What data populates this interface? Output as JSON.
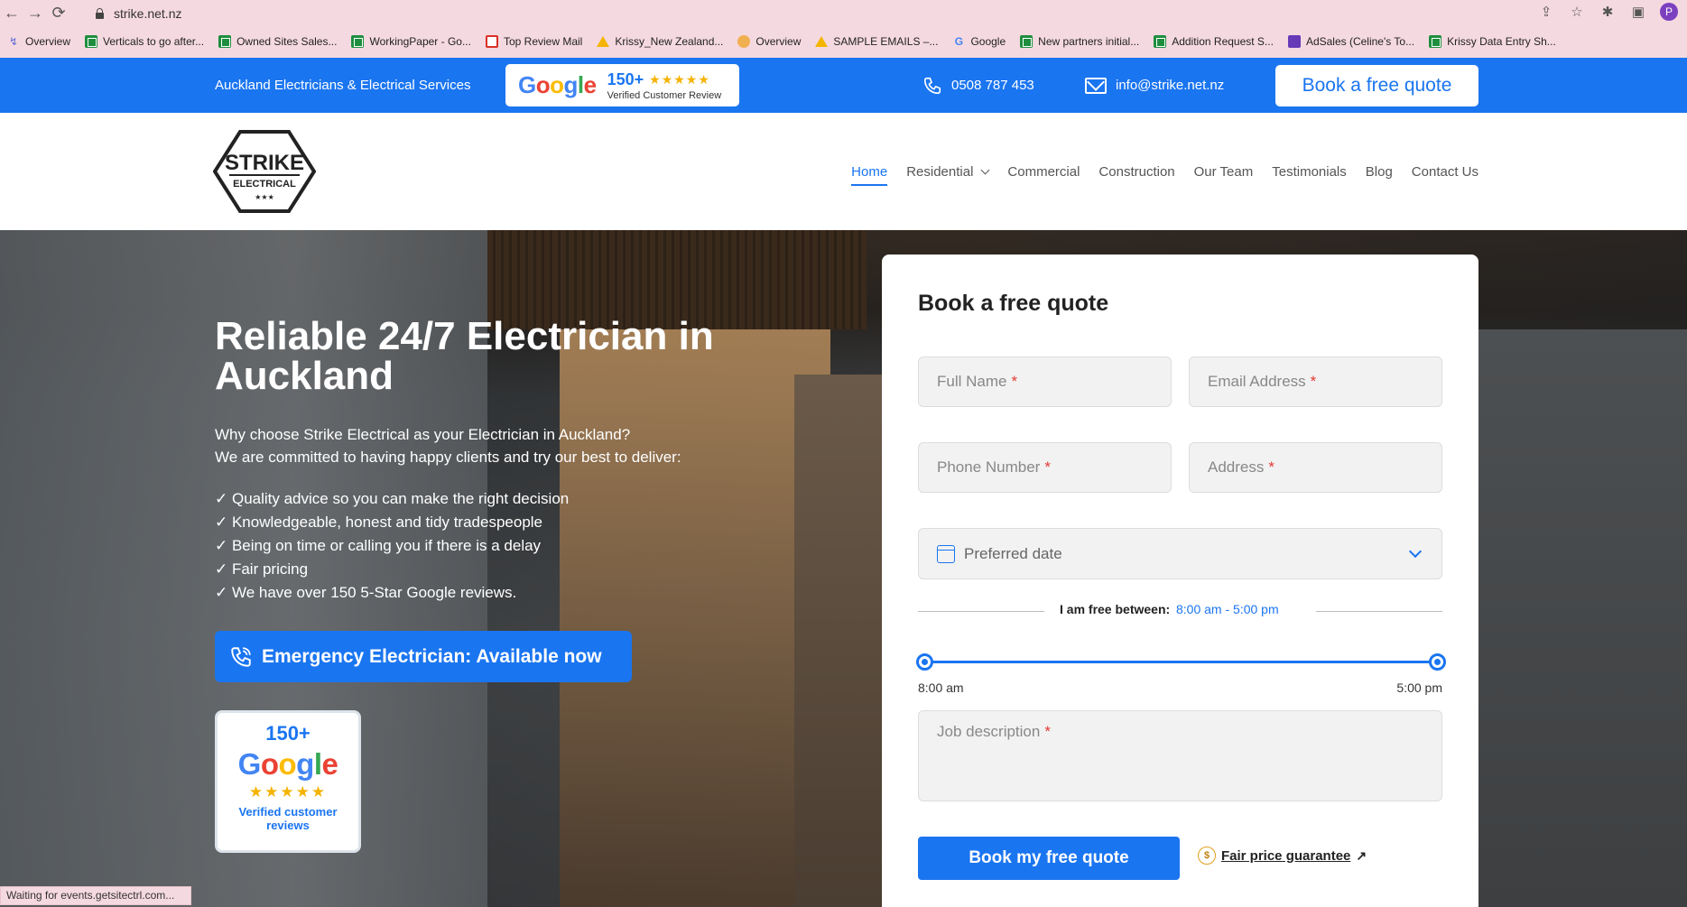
{
  "browser": {
    "url": "strike.net.nz",
    "profile_initial": "P",
    "bookmarks": [
      {
        "label": "Overview",
        "icon": "overview-icon"
      },
      {
        "label": "Verticals to go after...",
        "icon": "sheets-icon"
      },
      {
        "label": "Owned Sites Sales...",
        "icon": "sheets-icon"
      },
      {
        "label": "WorkingPaper - Go...",
        "icon": "sheets-icon"
      },
      {
        "label": "Top Review Mail",
        "icon": "gmail-icon"
      },
      {
        "label": "Krissy_New Zealand...",
        "icon": "drive-icon"
      },
      {
        "label": "Overview",
        "icon": "compass-icon"
      },
      {
        "label": "SAMPLE EMAILS –...",
        "icon": "drive-icon"
      },
      {
        "label": "Google",
        "icon": "google-icon"
      },
      {
        "label": "New partners initial...",
        "icon": "sheets-icon"
      },
      {
        "label": "Addition Request S...",
        "icon": "sheets-icon"
      },
      {
        "label": "AdSales (Celine's To...",
        "icon": "forms-icon"
      },
      {
        "label": "Krissy Data Entry Sh...",
        "icon": "sheets-icon"
      }
    ],
    "status_text": "Waiting for events.getsitectrl.com..."
  },
  "topbar": {
    "tagline": "Auckland Electricians & Electrical Services",
    "google_word": [
      "G",
      "o",
      "o",
      "g",
      "l",
      "e"
    ],
    "review_count": "150+",
    "stars": "★★★★★",
    "review_sub": "Verified Customer Review",
    "phone": "0508 787 453",
    "email": "info@strike.net.nz",
    "quote_button": "Book a free quote",
    "color_brand": "#1a75f0"
  },
  "header": {
    "logo_text_main": "STRIKE",
    "logo_text_sub": "ELECTRICAL",
    "logo_stars": "★★★",
    "nav": [
      {
        "label": "Home",
        "active": true
      },
      {
        "label": "Residential",
        "has_dropdown": true
      },
      {
        "label": "Commercial"
      },
      {
        "label": "Construction"
      },
      {
        "label": "Our Team"
      },
      {
        "label": "Testimonials"
      },
      {
        "label": "Blog"
      },
      {
        "label": "Contact Us"
      }
    ]
  },
  "hero": {
    "title": "Reliable 24/7 Electrician in Auckland",
    "intro_line1": "Why choose Strike Electrical as your Electrician in Auckland?",
    "intro_line2": "We are committed to having happy clients and try our best to deliver:",
    "points": [
      "Quality advice so you can make the right decision",
      "Knowledgeable, honest and tidy tradespeople",
      "Being on time or calling you if there is a delay",
      "Fair pricing",
      "We have over 150 5-Star Google reviews."
    ],
    "emergency_button": "Emergency Electrician: Available now",
    "google_card": {
      "count": "150+",
      "stars": "★★★★★",
      "subtitle": "Verified customer reviews"
    }
  },
  "form": {
    "title": "Book a free quote",
    "full_name_placeholder": "Full Name",
    "email_placeholder": "Email Address",
    "phone_placeholder": "Phone Number",
    "address_placeholder": "Address",
    "required_mark": "*",
    "date_placeholder": "Preferred date",
    "free_between_label": "I am free between:",
    "free_between_value": "8:00 am - 5:00 pm",
    "slider_min_label": "8:00 am",
    "slider_max_label": "5:00 pm",
    "slider_range_fraction": [
      0,
      1
    ],
    "job_placeholder": "Job description",
    "submit_button": "Book my free quote",
    "fair_price_label": "Fair price guarantee",
    "fair_price_arrow": "↗",
    "coin_symbol": "$"
  }
}
